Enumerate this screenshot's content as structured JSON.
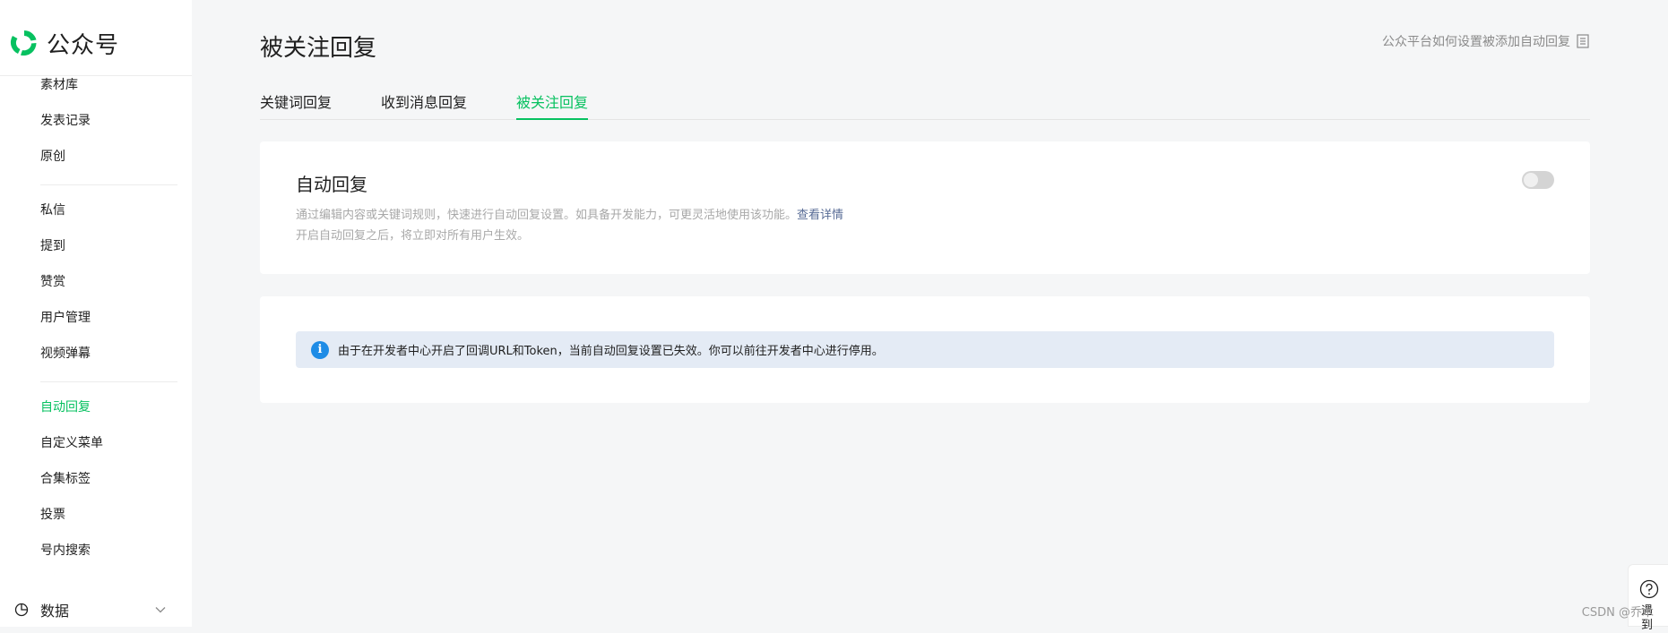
{
  "app": {
    "name": "公众号",
    "brand_color": "#07c160"
  },
  "sidebar": {
    "items": [
      {
        "label": "素材库"
      },
      {
        "label": "发表记录"
      },
      {
        "label": "原创"
      },
      {
        "label": "私信"
      },
      {
        "label": "提到"
      },
      {
        "label": "赞赏"
      },
      {
        "label": "用户管理"
      },
      {
        "label": "视频弹幕"
      },
      {
        "label": "自动回复",
        "active": true
      },
      {
        "label": "自定义菜单"
      },
      {
        "label": "合集标签"
      },
      {
        "label": "投票"
      },
      {
        "label": "号内搜索"
      }
    ],
    "group": {
      "label": "数据",
      "icon": "pie-chart-icon",
      "expand_icon": "chevron-down-icon"
    }
  },
  "header": {
    "title": "被关注回复",
    "help_link": "公众平台如何设置被添加自动回复",
    "help_icon": "document-icon"
  },
  "tabs": [
    {
      "label": "关键词回复",
      "active": false
    },
    {
      "label": "收到消息回复",
      "active": false
    },
    {
      "label": "被关注回复",
      "active": true
    }
  ],
  "auto_reply": {
    "title": "自动回复",
    "desc_line1": "通过编辑内容或关键词规则，快速进行自动回复设置。如具备开发能力，可更灵活地使用该功能。",
    "desc_link": "查看详情",
    "desc_line2": "开启自动回复之后，将立即对所有用户生效。",
    "toggle_on": false
  },
  "notice": {
    "icon": "info-icon",
    "icon_glyph": "i",
    "text": "由于在开发者中心开启了回调URL和Token，当前自动回复设置已失效。你可以前往开发者中心进行停用。"
  },
  "float_help": {
    "icon": "question-circle-icon",
    "label": "遇到"
  },
  "watermark": "CSDN @乔木"
}
